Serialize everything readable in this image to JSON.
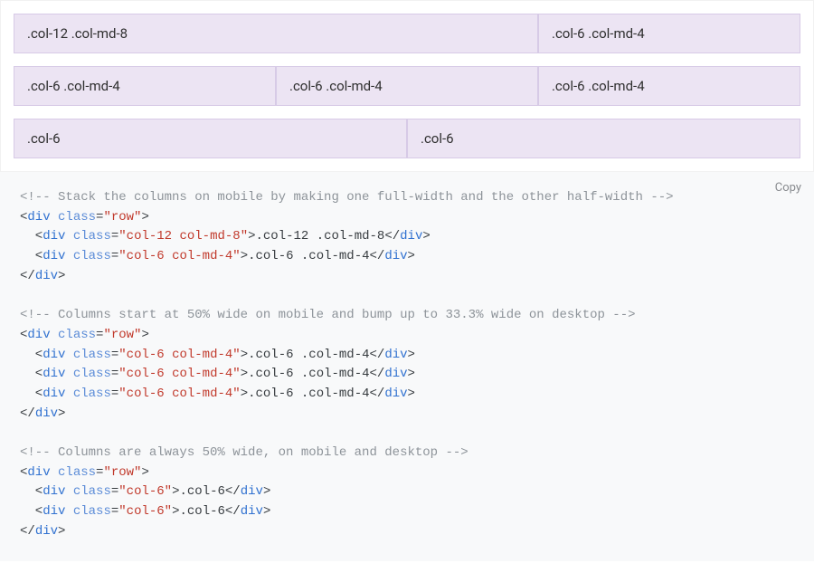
{
  "example": {
    "rows": [
      {
        "cols": [
          {
            "label": ".col-12 .col-md-8",
            "width": "w-66"
          },
          {
            "label": ".col-6 .col-md-4",
            "width": "w-33"
          }
        ]
      },
      {
        "cols": [
          {
            "label": ".col-6 .col-md-4",
            "width": "w-33"
          },
          {
            "label": ".col-6 .col-md-4",
            "width": "w-33"
          },
          {
            "label": ".col-6 .col-md-4",
            "width": "w-33"
          }
        ]
      },
      {
        "cols": [
          {
            "label": ".col-6",
            "width": "w-50"
          },
          {
            "label": ".col-6",
            "width": "w-50"
          }
        ]
      }
    ]
  },
  "code": {
    "copy_label": "Copy",
    "lines": [
      [
        {
          "cls": "c",
          "t": "<!-- Stack the columns on mobile by making one full-width and the other half-width -->"
        }
      ],
      [
        {
          "cls": "p",
          "t": "<"
        },
        {
          "cls": "nt",
          "t": "div"
        },
        {
          "cls": "p",
          "t": " "
        },
        {
          "cls": "na",
          "t": "class"
        },
        {
          "cls": "p",
          "t": "="
        },
        {
          "cls": "s",
          "t": "\"row\""
        },
        {
          "cls": "p",
          "t": ">"
        }
      ],
      [
        {
          "cls": "p",
          "t": "  <"
        },
        {
          "cls": "nt",
          "t": "div"
        },
        {
          "cls": "p",
          "t": " "
        },
        {
          "cls": "na",
          "t": "class"
        },
        {
          "cls": "p",
          "t": "="
        },
        {
          "cls": "s",
          "t": "\"col-12 col-md-8\""
        },
        {
          "cls": "p",
          "t": ">"
        },
        {
          "cls": "txt",
          "t": ".col-12 .col-md-8"
        },
        {
          "cls": "p",
          "t": "</"
        },
        {
          "cls": "nt",
          "t": "div"
        },
        {
          "cls": "p",
          "t": ">"
        }
      ],
      [
        {
          "cls": "p",
          "t": "  <"
        },
        {
          "cls": "nt",
          "t": "div"
        },
        {
          "cls": "p",
          "t": " "
        },
        {
          "cls": "na",
          "t": "class"
        },
        {
          "cls": "p",
          "t": "="
        },
        {
          "cls": "s",
          "t": "\"col-6 col-md-4\""
        },
        {
          "cls": "p",
          "t": ">"
        },
        {
          "cls": "txt",
          "t": ".col-6 .col-md-4"
        },
        {
          "cls": "p",
          "t": "</"
        },
        {
          "cls": "nt",
          "t": "div"
        },
        {
          "cls": "p",
          "t": ">"
        }
      ],
      [
        {
          "cls": "p",
          "t": "</"
        },
        {
          "cls": "nt",
          "t": "div"
        },
        {
          "cls": "p",
          "t": ">"
        }
      ],
      [
        {
          "cls": "p",
          "t": " "
        }
      ],
      [
        {
          "cls": "c",
          "t": "<!-- Columns start at 50% wide on mobile and bump up to 33.3% wide on desktop -->"
        }
      ],
      [
        {
          "cls": "p",
          "t": "<"
        },
        {
          "cls": "nt",
          "t": "div"
        },
        {
          "cls": "p",
          "t": " "
        },
        {
          "cls": "na",
          "t": "class"
        },
        {
          "cls": "p",
          "t": "="
        },
        {
          "cls": "s",
          "t": "\"row\""
        },
        {
          "cls": "p",
          "t": ">"
        }
      ],
      [
        {
          "cls": "p",
          "t": "  <"
        },
        {
          "cls": "nt",
          "t": "div"
        },
        {
          "cls": "p",
          "t": " "
        },
        {
          "cls": "na",
          "t": "class"
        },
        {
          "cls": "p",
          "t": "="
        },
        {
          "cls": "s",
          "t": "\"col-6 col-md-4\""
        },
        {
          "cls": "p",
          "t": ">"
        },
        {
          "cls": "txt",
          "t": ".col-6 .col-md-4"
        },
        {
          "cls": "p",
          "t": "</"
        },
        {
          "cls": "nt",
          "t": "div"
        },
        {
          "cls": "p",
          "t": ">"
        }
      ],
      [
        {
          "cls": "p",
          "t": "  <"
        },
        {
          "cls": "nt",
          "t": "div"
        },
        {
          "cls": "p",
          "t": " "
        },
        {
          "cls": "na",
          "t": "class"
        },
        {
          "cls": "p",
          "t": "="
        },
        {
          "cls": "s",
          "t": "\"col-6 col-md-4\""
        },
        {
          "cls": "p",
          "t": ">"
        },
        {
          "cls": "txt",
          "t": ".col-6 .col-md-4"
        },
        {
          "cls": "p",
          "t": "</"
        },
        {
          "cls": "nt",
          "t": "div"
        },
        {
          "cls": "p",
          "t": ">"
        }
      ],
      [
        {
          "cls": "p",
          "t": "  <"
        },
        {
          "cls": "nt",
          "t": "div"
        },
        {
          "cls": "p",
          "t": " "
        },
        {
          "cls": "na",
          "t": "class"
        },
        {
          "cls": "p",
          "t": "="
        },
        {
          "cls": "s",
          "t": "\"col-6 col-md-4\""
        },
        {
          "cls": "p",
          "t": ">"
        },
        {
          "cls": "txt",
          "t": ".col-6 .col-md-4"
        },
        {
          "cls": "p",
          "t": "</"
        },
        {
          "cls": "nt",
          "t": "div"
        },
        {
          "cls": "p",
          "t": ">"
        }
      ],
      [
        {
          "cls": "p",
          "t": "</"
        },
        {
          "cls": "nt",
          "t": "div"
        },
        {
          "cls": "p",
          "t": ">"
        }
      ],
      [
        {
          "cls": "p",
          "t": " "
        }
      ],
      [
        {
          "cls": "c",
          "t": "<!-- Columns are always 50% wide, on mobile and desktop -->"
        }
      ],
      [
        {
          "cls": "p",
          "t": "<"
        },
        {
          "cls": "nt",
          "t": "div"
        },
        {
          "cls": "p",
          "t": " "
        },
        {
          "cls": "na",
          "t": "class"
        },
        {
          "cls": "p",
          "t": "="
        },
        {
          "cls": "s",
          "t": "\"row\""
        },
        {
          "cls": "p",
          "t": ">"
        }
      ],
      [
        {
          "cls": "p",
          "t": "  <"
        },
        {
          "cls": "nt",
          "t": "div"
        },
        {
          "cls": "p",
          "t": " "
        },
        {
          "cls": "na",
          "t": "class"
        },
        {
          "cls": "p",
          "t": "="
        },
        {
          "cls": "s",
          "t": "\"col-6\""
        },
        {
          "cls": "p",
          "t": ">"
        },
        {
          "cls": "txt",
          "t": ".col-6"
        },
        {
          "cls": "p",
          "t": "</"
        },
        {
          "cls": "nt",
          "t": "div"
        },
        {
          "cls": "p",
          "t": ">"
        }
      ],
      [
        {
          "cls": "p",
          "t": "  <"
        },
        {
          "cls": "nt",
          "t": "div"
        },
        {
          "cls": "p",
          "t": " "
        },
        {
          "cls": "na",
          "t": "class"
        },
        {
          "cls": "p",
          "t": "="
        },
        {
          "cls": "s",
          "t": "\"col-6\""
        },
        {
          "cls": "p",
          "t": ">"
        },
        {
          "cls": "txt",
          "t": ".col-6"
        },
        {
          "cls": "p",
          "t": "</"
        },
        {
          "cls": "nt",
          "t": "div"
        },
        {
          "cls": "p",
          "t": ">"
        }
      ],
      [
        {
          "cls": "p",
          "t": "</"
        },
        {
          "cls": "nt",
          "t": "div"
        },
        {
          "cls": "p",
          "t": ">"
        }
      ]
    ]
  }
}
